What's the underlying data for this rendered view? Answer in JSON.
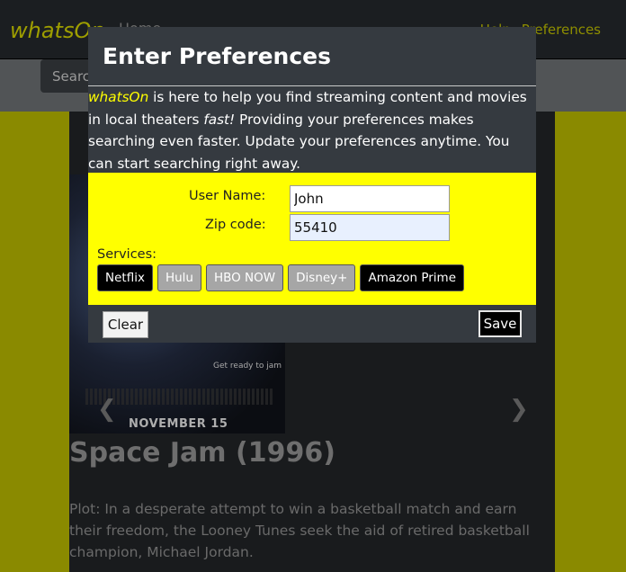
{
  "navbar": {
    "brand": "whatsOn",
    "home_label": "Home",
    "right_links": [
      "Help",
      "Preferences"
    ]
  },
  "search": {
    "placeholder": "Search"
  },
  "movie": {
    "poster_tagline": "Get ready to jam",
    "poster_date": "NOVEMBER 15",
    "title": "Space Jam (1996)",
    "plot": "Plot: In a desperate attempt to win a basketball match and earn their freedom, the Looney Tunes seek the aid of retired basketball champion, Michael Jordan."
  },
  "modal": {
    "title": "Enter Preferences",
    "intro_brand": "whatsOn",
    "intro_part1": " is here to help you find streaming content and movies in local theaters ",
    "intro_emphasis": "fast!",
    "intro_part2": " Providing your preferences makes searching even faster. Update your preferences anytime. You can start searching right away.",
    "username_label": "User Name:",
    "username_value": "John",
    "zip_label": "Zip code:",
    "zip_value": "55410",
    "services_label": "Services:",
    "services": [
      {
        "label": "Netflix",
        "selected": true
      },
      {
        "label": "Hulu",
        "selected": false
      },
      {
        "label": "HBO NOW",
        "selected": false
      },
      {
        "label": "Disney+",
        "selected": false
      },
      {
        "label": "Amazon Prime",
        "selected": true
      }
    ],
    "clear_label": "Clear",
    "save_label": "Save"
  },
  "colors": {
    "accent_yellow": "#ffff00",
    "modal_bg": "#353a40",
    "page_olive": "#8a8a00"
  }
}
